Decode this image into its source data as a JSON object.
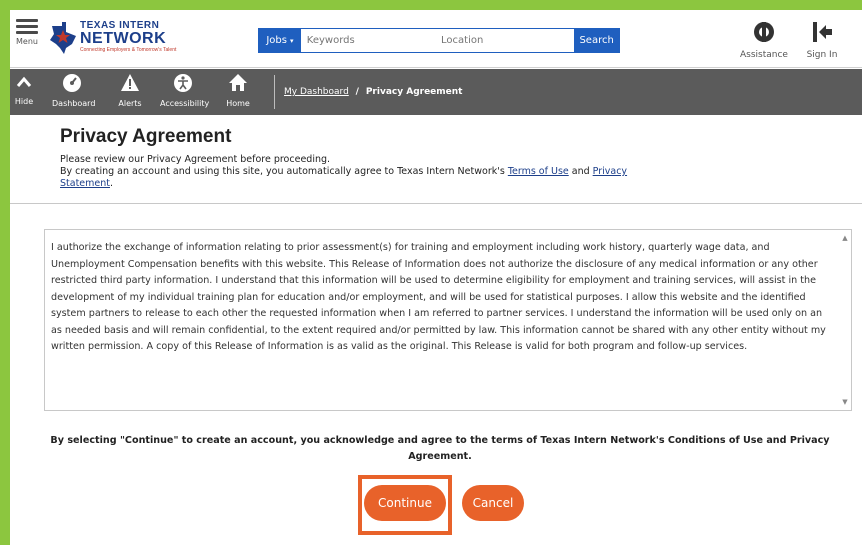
{
  "header": {
    "menu_label": "Menu",
    "logo": {
      "line1": "TEXAS INTERN",
      "line2": "NETWORK",
      "tagline": "Connecting Employers & Tomorrow's Talent"
    },
    "search": {
      "category": "Jobs",
      "keyword_placeholder": "Keywords",
      "location_placeholder": "Location",
      "button": "Search"
    },
    "assistance_label": "Assistance",
    "signin_label": "Sign In"
  },
  "nav": {
    "hide_label": "Hide",
    "items": [
      {
        "label": "Dashboard",
        "icon": "dashboard-icon"
      },
      {
        "label": "Alerts",
        "icon": "alert-icon"
      },
      {
        "label": "Accessibility",
        "icon": "accessibility-icon"
      },
      {
        "label": "Home",
        "icon": "home-icon"
      }
    ],
    "breadcrumb": {
      "parent": "My Dashboard",
      "separator": "/",
      "current": "Privacy Agreement"
    }
  },
  "page": {
    "title": "Privacy Agreement",
    "intro_line1": "Please review our Privacy Agreement before proceeding.",
    "intro_line2_pre": "By creating an account and using this site, you automatically agree to Texas Intern Network's ",
    "terms_link": "Terms of Use",
    "and": " and ",
    "privacy_link_1": "Privacy",
    "privacy_link_2": "Statement",
    "period": ".",
    "release_text": "I authorize the exchange of information relating to prior assessment(s) for training and employment including work history, quarterly wage data, and Unemployment Compensation benefits with this website. This Release of Information does not authorize the disclosure of any medical information or any other restricted third party information. I understand that this information will be used to determine eligibility for employment and training services, will assist in the development of my individual training plan for education and/or employment, and will be used for statistical purposes. I allow this website and the identified system partners to release to each other the requested information when I am referred to partner services. I understand the information will be used only on an as needed basis and will remain confidential, to the extent required and/or permitted by law. This information cannot be shared with any other entity without my written permission. A copy of this Release of Information is as valid as the original. This Release is valid for both program and follow-up services.",
    "acknowledge": "By selecting \"Continue\" to create an account, you acknowledge and agree to the terms of Texas Intern Network's Conditions of Use and Privacy Agreement.",
    "continue_label": "Continue",
    "cancel_label": "Cancel"
  },
  "colors": {
    "frame_green": "#8cc63f",
    "brand_blue": "#1d3f8a",
    "search_blue": "#1f5fbf",
    "nav_gray": "#5b5b5b",
    "accent_orange": "#e8622a"
  }
}
